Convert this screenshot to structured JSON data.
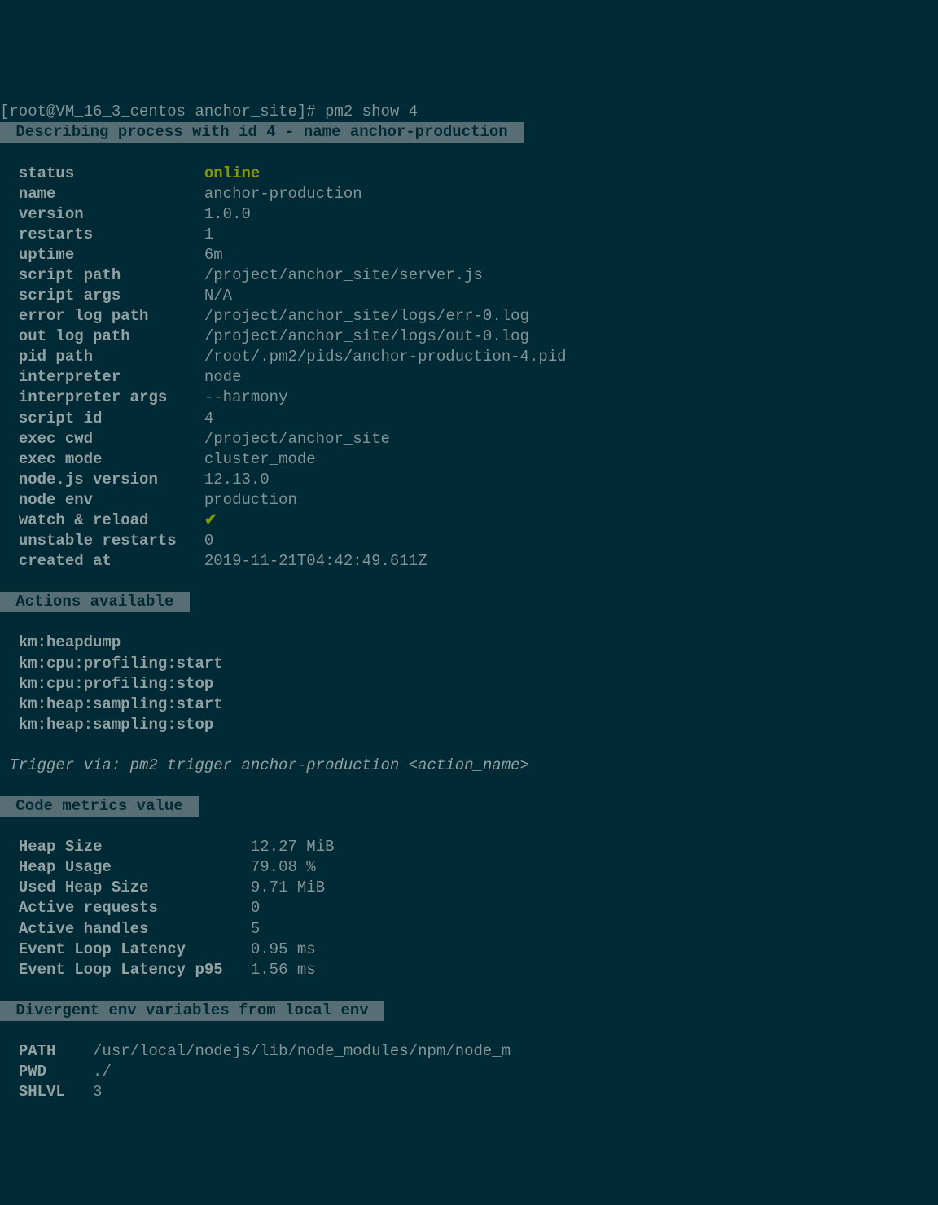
{
  "prompt": "[root@VM_16_3_centos anchor_site]# pm2 show 4",
  "sections": {
    "describing": {
      "title": " Describing process with id 4 - name anchor-production ",
      "rows": [
        {
          "key": "status",
          "val": "online",
          "green": true
        },
        {
          "key": "name",
          "val": "anchor-production"
        },
        {
          "key": "version",
          "val": "1.0.0"
        },
        {
          "key": "restarts",
          "val": "1"
        },
        {
          "key": "uptime",
          "val": "6m"
        },
        {
          "key": "script path",
          "val": "/project/anchor_site/server.js"
        },
        {
          "key": "script args",
          "val": "N/A"
        },
        {
          "key": "error log path",
          "val": "/project/anchor_site/logs/err-0.log"
        },
        {
          "key": "out log path",
          "val": "/project/anchor_site/logs/out-0.log"
        },
        {
          "key": "pid path",
          "val": "/root/.pm2/pids/anchor-production-4.pid"
        },
        {
          "key": "interpreter",
          "val": "node"
        },
        {
          "key": "interpreter args",
          "val": "--harmony"
        },
        {
          "key": "script id",
          "val": "4"
        },
        {
          "key": "exec cwd",
          "val": "/project/anchor_site"
        },
        {
          "key": "exec mode",
          "val": "cluster_mode"
        },
        {
          "key": "node.js version",
          "val": "12.13.0"
        },
        {
          "key": "node env",
          "val": "production"
        },
        {
          "key": "watch & reload",
          "val": "✔",
          "check": true
        },
        {
          "key": "unstable restarts",
          "val": "0"
        },
        {
          "key": "created at",
          "val": "2019-11-21T04:42:49.611Z"
        }
      ]
    },
    "actions": {
      "title": " Actions available ",
      "items": [
        "km:heapdump",
        "km:cpu:profiling:start",
        "km:cpu:profiling:stop",
        "km:heap:sampling:start",
        "km:heap:sampling:stop"
      ],
      "trigger": " Trigger via: pm2 trigger anchor-production <action_name>"
    },
    "metrics": {
      "title": " Code metrics value ",
      "rows": [
        {
          "key": "Heap Size",
          "val": "12.27 MiB"
        },
        {
          "key": "Heap Usage",
          "val": "79.08 %"
        },
        {
          "key": "Used Heap Size",
          "val": "9.71 MiB"
        },
        {
          "key": "Active requests",
          "val": "0"
        },
        {
          "key": "Active handles",
          "val": "5"
        },
        {
          "key": "Event Loop Latency",
          "val": "0.95 ms"
        },
        {
          "key": "Event Loop Latency p95",
          "val": "1.56 ms"
        }
      ]
    },
    "divergent": {
      "title": " Divergent env variables from local env ",
      "rows": [
        {
          "key": "PATH",
          "val": "/usr/local/nodejs/lib/node_modules/npm/node_m"
        },
        {
          "key": "PWD",
          "val": "./"
        },
        {
          "key": "SHLVL",
          "val": "3"
        }
      ]
    }
  }
}
